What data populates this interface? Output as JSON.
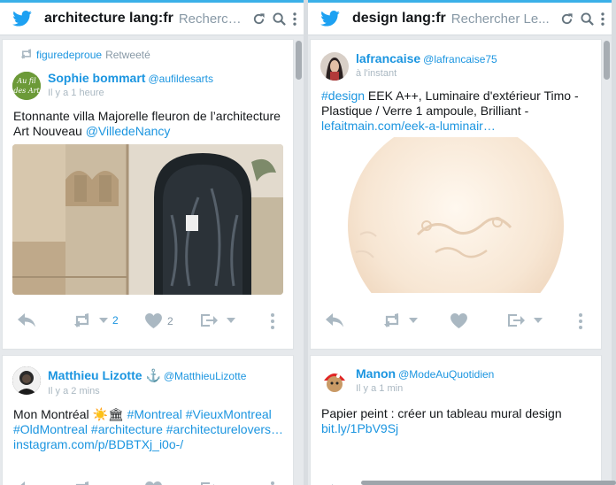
{
  "columns": [
    {
      "title": "architecture lang:fr",
      "search_hint": "Rechercher...",
      "tweets": [
        {
          "retweeted_by": "figuredeproue",
          "retweet_label": "Retweeté",
          "author": "Sophie bommart",
          "handle": "@aufildesarts",
          "avatar_text": "Au fil des Art",
          "time": "Il y a 1 heure",
          "text_plain": "Etonnante villa Majorelle fleuron de l’architecture Art Nouveau ",
          "text_link": "@VilledeNancy",
          "media": "photo-art-nouveau-villa",
          "retweet_count": "2",
          "like_count": "2"
        },
        {
          "author": "Matthieu Lizotte",
          "author_badge": "⚓",
          "handle": "@MatthieuLizotte",
          "time": "Il y a 2 mins",
          "text_plain": "Mon Montréal ☀️🏛 ",
          "text_link_1": "#Montreal #VieuxMontreal",
          "text_link_2": "#OldMontreal #architecture #architecturelovers…",
          "text_link_3": "instagram.com/p/BDBTXj_i0o-/"
        }
      ]
    },
    {
      "title": "design lang:fr",
      "search_hint": "Rechercher Le...",
      "tweets": [
        {
          "author": "lafrancaise",
          "handle": "@lafrancaise75",
          "time": "à l'instant",
          "text_hashtag": "#design",
          "text_plain": " EEK A++, Luminaire d'extérieur Timo - Plastique / Verre 1 ampoule, Brilliant -",
          "text_link": "lefaitmain.com/eek-a-luminair…",
          "media": "photo-glass-globe"
        },
        {
          "author": "Manon",
          "handle": "@ModeAuQuotidien",
          "time": "Il y a 1 min",
          "text_plain": "Papier peint : créer un tableau mural design",
          "text_link": "bit.ly/1PbV9Sj"
        }
      ]
    }
  ],
  "icons": {
    "column_bird": "twitter-bird-icon",
    "header_actions": [
      "refresh-icon",
      "search-icon",
      "more-vertical-icon"
    ],
    "tweet_actions": [
      "reply-icon",
      "retweet-icon",
      "like-icon",
      "share-icon",
      "more-vertical-icon"
    ]
  },
  "colors": {
    "brand": "#1da1f2",
    "link": "#1b95e0",
    "muted": "#aab8c2"
  }
}
